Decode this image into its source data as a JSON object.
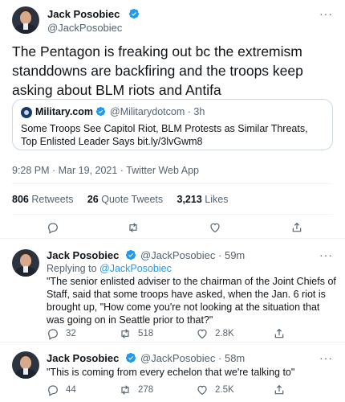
{
  "main_tweet": {
    "author_name": "Jack Posobiec",
    "author_handle": "@JackPosobiec",
    "text": "The Pentagon is freaking out bc the extremism standdowns are backfiring and the troops keep asking about BLM riots and Antifa",
    "more_label": "···",
    "quote": {
      "source_name": "Military.com",
      "source_handle": "@Militarydotcom · 3h",
      "text": "Some Troops See Capitol Riot, BLM Protests as Similar Threats, Top Enlisted Leader Says bit.ly/3lvGwm8"
    },
    "timestamp": "9:28 PM · Mar 19, 2021 · Twitter Web App",
    "stats": {
      "retweets_count": "806",
      "retweets_label": "Retweets",
      "quotes_count": "26",
      "quotes_label": "Quote Tweets",
      "likes_count": "3,213",
      "likes_label": "Likes"
    }
  },
  "replies": [
    {
      "author_name": "Jack Posobiec",
      "meta": "@JackPosobiec · 59m",
      "replying_prefix": "Replying to",
      "replying_handle": "@JackPosobiec",
      "text": "\"The senior enlisted adviser to the chairman of the Joint Chiefs of Staff, said that some troops have asked, when the Jan. 6 riot is brought up, \"How come you're not looking at the situation that was going on in Seattle prior to that?\"",
      "replies_count": "32",
      "retweets_count": "518",
      "likes_count": "2.8K"
    },
    {
      "author_name": "Jack Posobiec",
      "meta": "@JackPosobiec · 58m",
      "text": "\"This is coming from every echelon that we're talking to\"",
      "replies_count": "44",
      "retweets_count": "278",
      "likes_count": "2.5K"
    }
  ],
  "colors": {
    "accent": "#1d9bf0",
    "muted": "#536471",
    "text": "#0f1419",
    "border": "#eff3f4"
  }
}
